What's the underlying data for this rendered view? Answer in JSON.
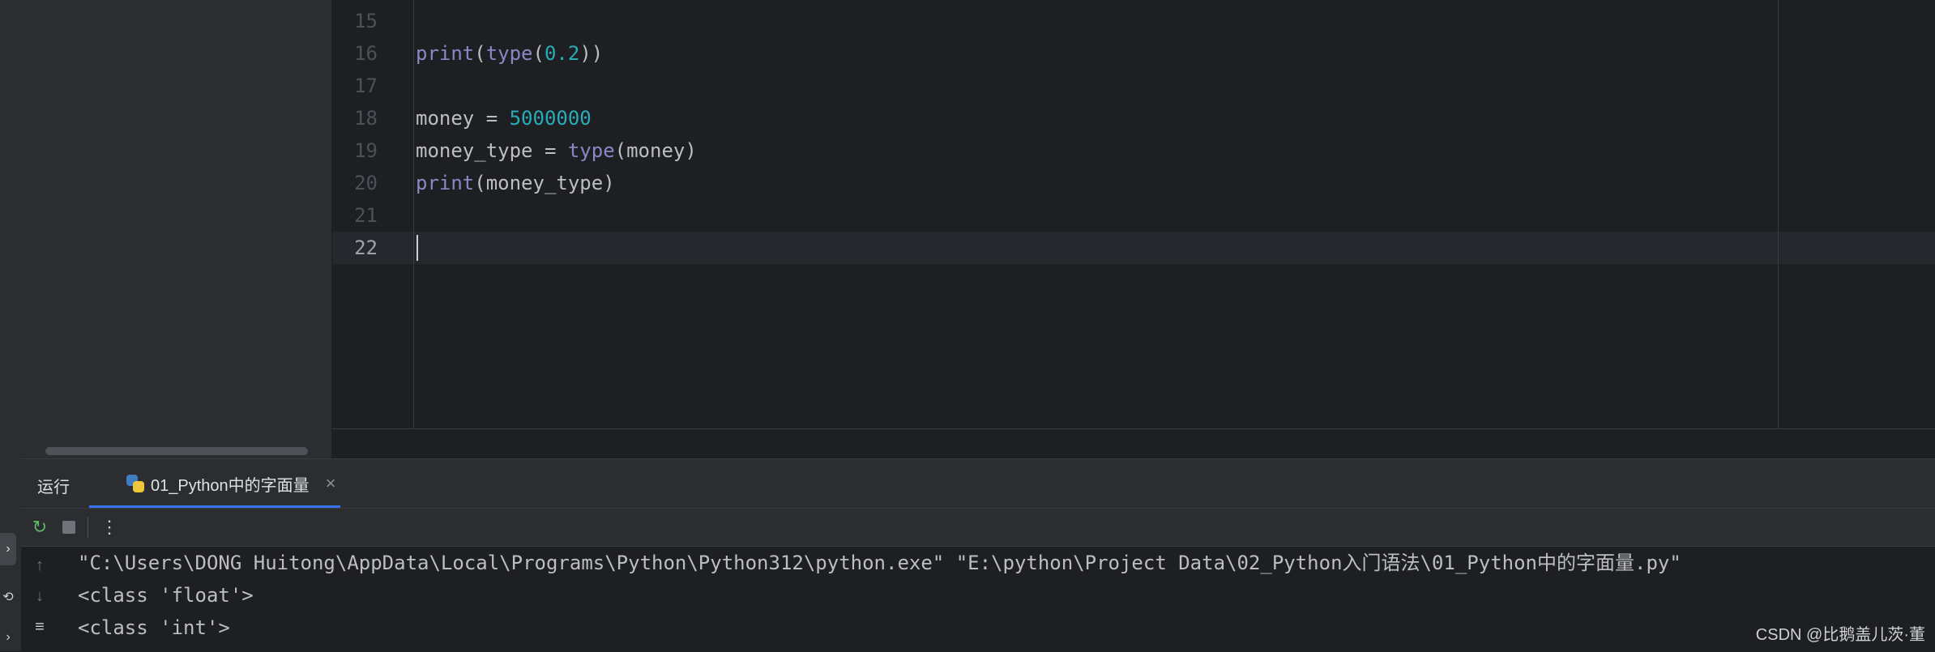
{
  "editor": {
    "lines": [
      {
        "number": "15",
        "tokens": []
      },
      {
        "number": "16",
        "tokens": [
          {
            "t": "print",
            "c": "builtin"
          },
          {
            "t": "(",
            "c": ""
          },
          {
            "t": "type",
            "c": "builtin"
          },
          {
            "t": "(",
            "c": ""
          },
          {
            "t": "0.2",
            "c": "num"
          },
          {
            "t": "))",
            "c": ""
          }
        ]
      },
      {
        "number": "17",
        "tokens": []
      },
      {
        "number": "18",
        "tokens": [
          {
            "t": "money = ",
            "c": ""
          },
          {
            "t": "5000000",
            "c": "num"
          }
        ]
      },
      {
        "number": "19",
        "tokens": [
          {
            "t": "money_type = ",
            "c": ""
          },
          {
            "t": "type",
            "c": "builtin"
          },
          {
            "t": "(money)",
            "c": ""
          }
        ]
      },
      {
        "number": "20",
        "tokens": [
          {
            "t": "print",
            "c": "builtin"
          },
          {
            "t": "(money_type)",
            "c": ""
          }
        ]
      },
      {
        "number": "21",
        "tokens": []
      },
      {
        "number": "22",
        "tokens": [],
        "current": true
      }
    ]
  },
  "run_panel": {
    "title": "运行",
    "tab_label": "01_Python中的字面量",
    "tab_close": "×",
    "more_icon": "⋮",
    "console_lines": [
      "\"C:\\Users\\DONG Huitong\\AppData\\Local\\Programs\\Python\\Python312\\python.exe\" \"E:\\python\\Project Data\\02_Python入门语法\\01_Python中的字面量.py\"",
      "<class 'float'>",
      "<class 'int'>"
    ]
  },
  "watermark": "CSDN @比鹅盖儿茨·董",
  "colors": {
    "background": "#1e1f22",
    "panel": "#2b2d30",
    "builtin": "#8888c6",
    "number": "#2aacb8",
    "text": "#bcbec4",
    "accent": "#3574f0"
  },
  "icons": {
    "left_strip": [
      "run-icon",
      "debug-icon",
      "terminal-icon"
    ],
    "toolbar": [
      "rerun-icon",
      "stop-icon",
      "more-icon"
    ],
    "console_gutter": [
      "up-arrow-icon",
      "down-arrow-icon",
      "soft-wrap-icon"
    ]
  }
}
